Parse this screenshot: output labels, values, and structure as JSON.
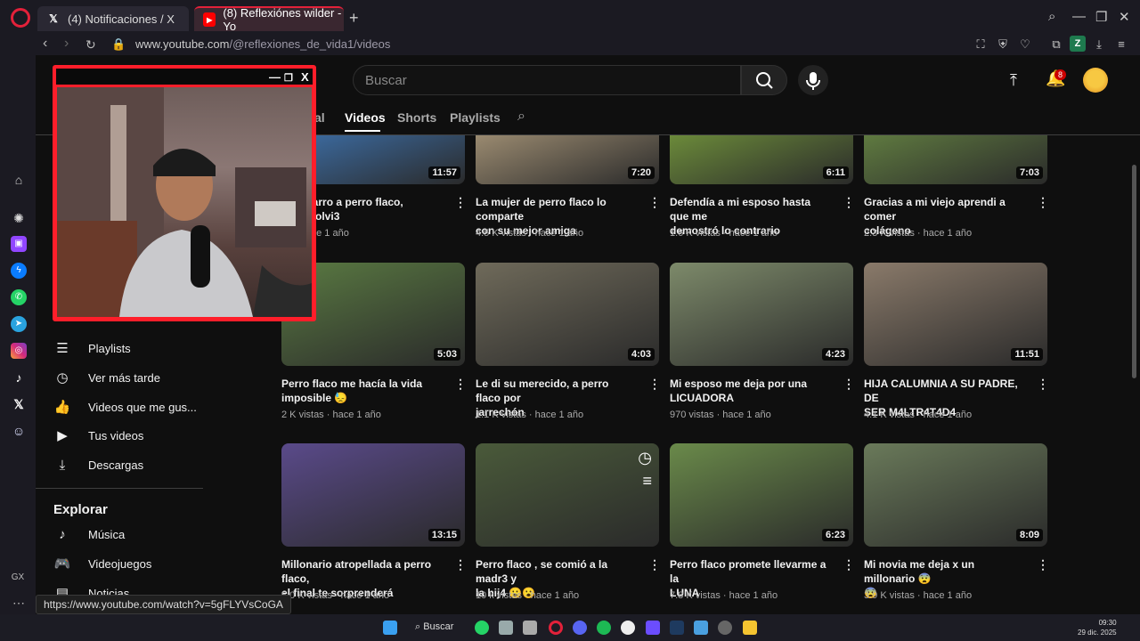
{
  "browser": {
    "tabs": [
      {
        "label": "(4) Notificaciones / X",
        "icon": "x-logo-icon"
      },
      {
        "label": "(8) Reflexiónes wilder - Yo",
        "icon": "youtube-icon"
      }
    ],
    "url_domain": "www.youtube.com",
    "url_path": "/@reflexiones_de_vida1/videos",
    "profile_badge": "Z",
    "sidebar_bottom_label": "GX",
    "status_url": "https://www.youtube.com/watch?v=5gFLYVsCoGA"
  },
  "youtube": {
    "search_placeholder": "Buscar",
    "notification_count": "8",
    "channel_tabs": [
      "al",
      "Videos",
      "Shorts",
      "Playlists"
    ],
    "menu": [
      {
        "label": "Playlists",
        "icon": "playlist-icon"
      },
      {
        "label": "Ver más tarde",
        "icon": "clock-icon"
      },
      {
        "label": "Videos que me gus...",
        "icon": "thumbs-up-icon"
      },
      {
        "label": "Tus videos",
        "icon": "play-square-icon"
      },
      {
        "label": "Descargas",
        "icon": "download-icon"
      }
    ],
    "explore_title": "Explorar",
    "explore_items": [
      {
        "label": "Música",
        "icon": "music-note-icon"
      },
      {
        "label": "Videojuegos",
        "icon": "gamepad-icon"
      },
      {
        "label": "Noticias",
        "icon": "newspaper-icon"
      }
    ],
    "videos": [
      {
        "title_l1": "é un carro a perro flaco,",
        "title_l2": "e me polvi3",
        "meta": "as · hace 1 año",
        "duration": "11:57",
        "color": "#3d6fa8"
      },
      {
        "title_l1": "La mujer de perro flaco lo comparte",
        "title_l2": "con su mejor amiga",
        "meta": "4.5 K vistas · hace 1 año",
        "duration": "7:20",
        "color": "#9a8a70"
      },
      {
        "title_l1": "Defendía a mi esposo hasta que me",
        "title_l2": "demostró lo contrario",
        "meta": "1.6 K vistas · hace 1 año",
        "duration": "6:11",
        "color": "#6b8a3a"
      },
      {
        "title_l1": "Gracias a mi viejo aprendi a comer",
        "title_l2": "colágeno",
        "meta": "2.3 K vistas · hace 1 año",
        "duration": "7:03",
        "color": "#5f7a40"
      },
      {
        "title_l1": "Perro flaco me hacía la vida",
        "title_l2": "imposible 😓",
        "meta": "2 K vistas · hace 1 año",
        "duration": "5:03",
        "color": "#5a7a42"
      },
      {
        "title_l1": "Le di su merecido, a perro flaco por",
        "title_l2": "jarrechón",
        "meta": "1.1 K vistas · hace 1 año",
        "duration": "4:03",
        "color": "#6f6a5a"
      },
      {
        "title_l1": "Mi esposo me deja por una",
        "title_l2": "LICUADORA",
        "meta": "970 vistas · hace 1 año",
        "duration": "4:23",
        "color": "#7d8a6a"
      },
      {
        "title_l1": "HIJA CALUMNIA A SU PADRE, DE",
        "title_l2": "SER M4LTR4T4D4",
        "meta": "4.1 K vistas · hace 1 año",
        "duration": "11:51",
        "color": "#8a7a6a"
      },
      {
        "title_l1": "Millonario atropellada a perro flaco,",
        "title_l2": "el final te sorprenderá",
        "meta": "5.0 K vistas · hace 1 año",
        "duration": "13:15",
        "color": "#5a4a8a"
      },
      {
        "title_l1": "Perro flaco , se comió a la madr3 y",
        "title_l2": "la hij4 😮😮",
        "meta": "10 k vistas · hace 1 año",
        "duration": "",
        "color": "#4a5a3a"
      },
      {
        "title_l1": "Perro flaco promete llevarme a la",
        "title_l2": "LUNA",
        "meta": "7.8 K vistas · hace 1 año",
        "duration": "6:23",
        "color": "#6a8a4a"
      },
      {
        "title_l1": "Mi novia me deja x un millonario 😨",
        "title_l2": "😨",
        "meta": "3.9 K vistas · hace 1 año",
        "duration": "8:09",
        "color": "#6a7a5a"
      }
    ]
  },
  "taskbar": {
    "search_label": "Buscar",
    "time": "09:30",
    "date": "29 dic. 2025"
  }
}
